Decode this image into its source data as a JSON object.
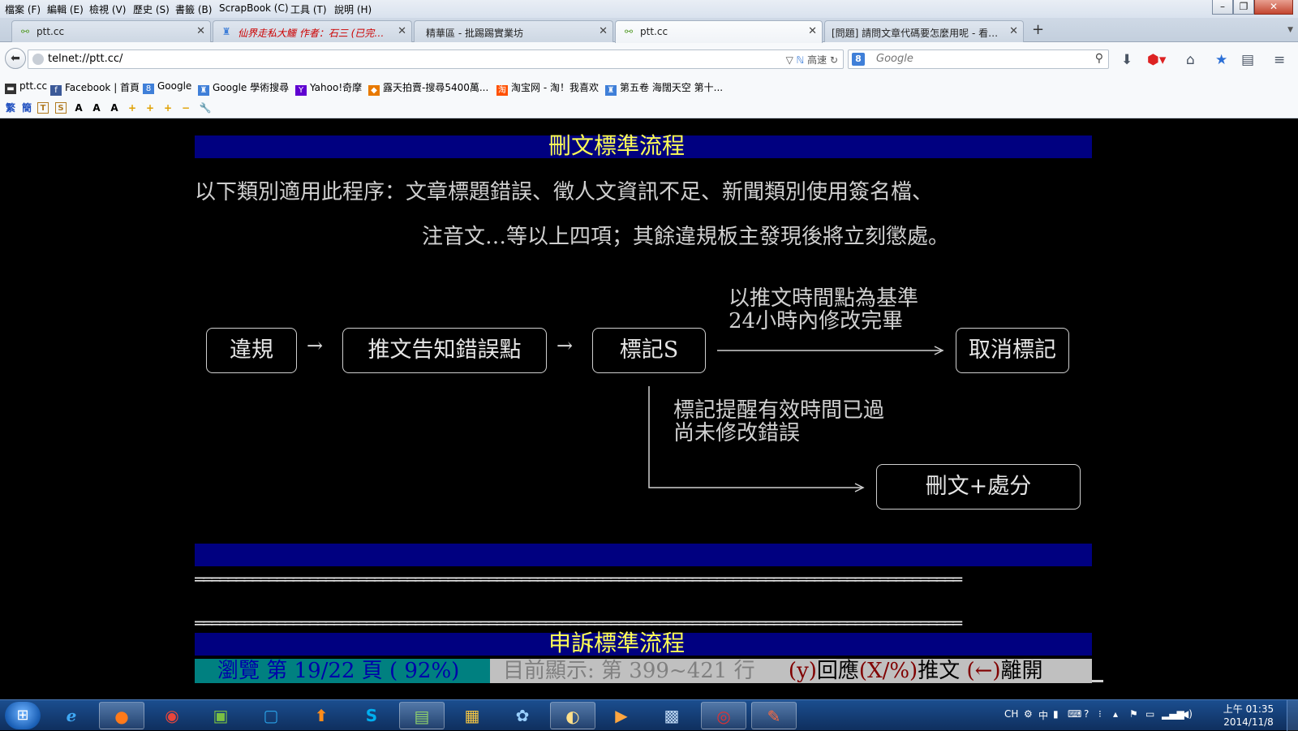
{
  "menubar": {
    "items": [
      "檔案 (F)",
      "編輯 (E)",
      "檢視 (V)",
      "歷史 (S)",
      "書籤 (B)",
      "ScrapBook (C)",
      "工具 (T)",
      "說明 (H)"
    ]
  },
  "window_controls": {
    "minimize": "–",
    "maximize": "❐",
    "close": "✕"
  },
  "tabs": [
    {
      "title": "ptt.cc",
      "icon": "link-icon",
      "active": false
    },
    {
      "title": "仙界走私大鱷 作者：石三 (已完成)...",
      "icon": "castle-icon",
      "active": false
    },
    {
      "title": "精華區 - 批踢踢實業坊",
      "icon": "",
      "active": false
    },
    {
      "title": "ptt.cc",
      "icon": "link-icon",
      "active": true
    },
    {
      "title": "[問題] 請問文章代碼要怎麼用呢 - 看板...",
      "icon": "",
      "active": false
    }
  ],
  "navbar": {
    "url": "telnet://ptt.cc/",
    "speed_label": "高速",
    "search_placeholder": "Google"
  },
  "bookmarks": [
    {
      "label": "ptt.cc",
      "icon": "terminal-icon",
      "color": "#333333"
    },
    {
      "label": "Facebook | 首頁",
      "icon": "facebook-icon",
      "color": "#3b5998"
    },
    {
      "label": "Google",
      "icon": "google-icon",
      "color": "#3f7fd8"
    },
    {
      "label": "Google 學術搜尋",
      "icon": "scholar-icon",
      "color": "#3f7fd8"
    },
    {
      "label": "Yahoo!奇摩",
      "icon": "yahoo-icon",
      "color": "#5f01d1"
    },
    {
      "label": "露天拍賣-搜尋5400萬...",
      "icon": "ruten-icon",
      "color": "#e87a00"
    },
    {
      "label": "淘宝网 - 淘！我喜欢",
      "icon": "taobao-icon",
      "color": "#ff5000"
    },
    {
      "label": "第五卷 海闊天空 第十...",
      "icon": "castle-icon",
      "color": "#3f7fd8"
    }
  ],
  "addon_toolbar": {
    "items": [
      "繁",
      "簡",
      "T",
      "S",
      "A",
      "A",
      "A",
      "+",
      "+",
      "+",
      "−",
      "🔧"
    ]
  },
  "content": {
    "delete_title": "刪文標準流程",
    "rule_line1": "以下類別適用此程序：文章標題錯誤、徵人文資訊不足、新聞類別使用簽名檔、",
    "rule_line2": "注音文…等以上四項；其餘違規板主發現後將立刻懲處。",
    "flow": {
      "violation": "違規",
      "notify": "推文告知錯誤點",
      "mark": "標記S",
      "cancel": "取消標記",
      "penalty": "刪文+處分",
      "arrow": "→",
      "condition_line1": "以推文時間點為基準",
      "condition_line2": "24小時內修改完畢",
      "expired_line1": "標記提醒有效時間已過",
      "expired_line2": "尚未修改錯誤"
    },
    "divider": "══════════════════════════════════════════════════════════════════════════════════════════════",
    "appeal_title": "申訴標準流程"
  },
  "status": {
    "browse": "瀏覽 第 19/22 頁 ( 92%)",
    "showing": "目前顯示: 第 399~421 行",
    "reply_key": "(y)",
    "reply": "回應",
    "push_key": "(X/%)",
    "push": "推文",
    "leave_key": "(←)",
    "leave": "離開"
  },
  "taskbar": {
    "apps": [
      {
        "name": "ie",
        "glyph": "e",
        "color": "#3fa9f5",
        "running": false
      },
      {
        "name": "firefox",
        "glyph": "●",
        "color": "#ff7a1a",
        "running": true
      },
      {
        "name": "chrome",
        "glyph": "◉",
        "color": "#e9453a",
        "running": false
      },
      {
        "name": "vmware",
        "glyph": "▣",
        "color": "#7ac143",
        "running": false
      },
      {
        "name": "outlook",
        "glyph": "▢",
        "color": "#2aa3e8",
        "running": false
      },
      {
        "name": "transmission",
        "glyph": "⬆",
        "color": "#ff8c1a",
        "running": false
      },
      {
        "name": "skype",
        "glyph": "S",
        "color": "#00aff0",
        "running": false
      },
      {
        "name": "chart-app",
        "glyph": "▤",
        "color": "#8fd16b",
        "running": true
      },
      {
        "name": "explorer",
        "glyph": "▦",
        "color": "#f5c542",
        "running": false
      },
      {
        "name": "network",
        "glyph": "✿",
        "color": "#9ad0ff",
        "running": false
      },
      {
        "name": "burn",
        "glyph": "◐",
        "color": "#ffe08a",
        "running": true
      },
      {
        "name": "media",
        "glyph": "▶",
        "color": "#ffa640",
        "running": false
      },
      {
        "name": "remote",
        "glyph": "▩",
        "color": "#bcd6f2",
        "running": false
      },
      {
        "name": "pcman",
        "glyph": "◎",
        "color": "#e53030",
        "running": true
      },
      {
        "name": "paint",
        "glyph": "✎",
        "color": "#ff6a3d",
        "running": true
      }
    ],
    "tray": {
      "lang": "CH",
      "ime": "中"
    },
    "clock_time": "上午 01:35",
    "clock_date": "2014/11/8"
  }
}
